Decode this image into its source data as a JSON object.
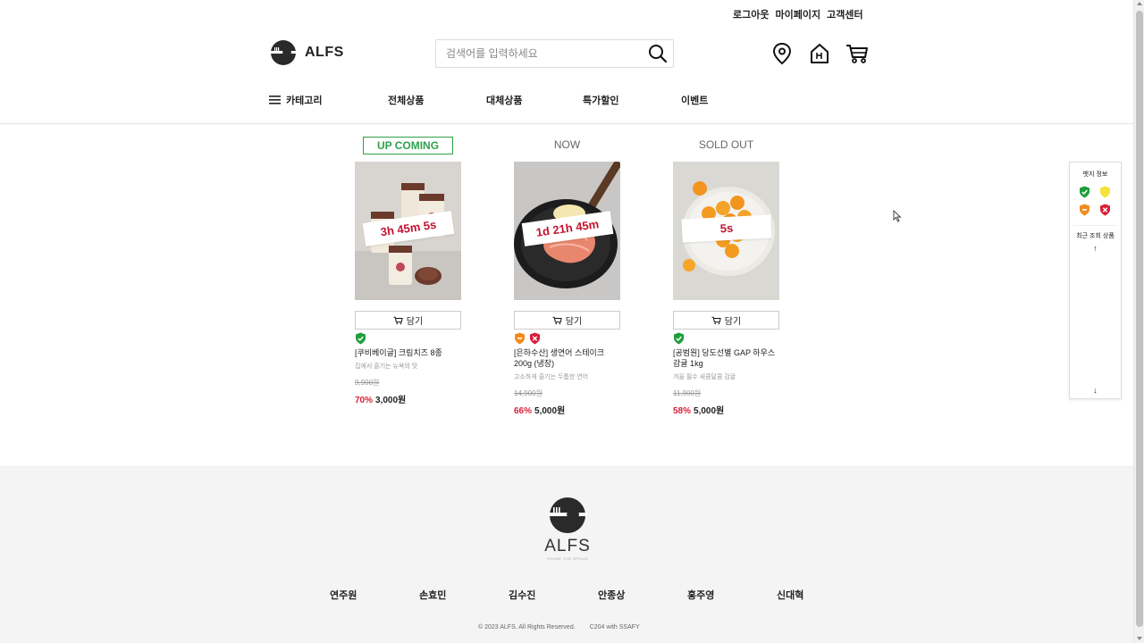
{
  "top_links": [
    "로그아웃",
    "마이페이지",
    "고객센터"
  ],
  "header": {
    "logo_text": "ALFS",
    "search_placeholder": "검색어를 입력하세요"
  },
  "nav": {
    "category": "카테고리",
    "items": [
      "전체상품",
      "대체상품",
      "특가할인",
      "이벤트"
    ]
  },
  "products": [
    {
      "status": "UP COMING",
      "timer": "3h 45m 5s",
      "cart_label": "담기",
      "name": "[쿠비베이글] 크림치즈 8종",
      "desc": "집에서 즐기는 뉴욕의 맛",
      "orig_price": "9,900원",
      "discount": "70%",
      "price": "3,000원",
      "badges": [
        "green"
      ]
    },
    {
      "status": "NOW",
      "timer": "1d 21h 45m",
      "cart_label": "담기",
      "name": "[은하수산] 생연어 스테이크 200g (냉장)",
      "desc": "고소하게 즐기는 두툼한 연어",
      "orig_price": "14,900원",
      "discount": "66%",
      "price": "5,000원",
      "badges": [
        "orange",
        "red"
      ]
    },
    {
      "status": "SOLD OUT",
      "timer": "5s",
      "cart_label": "담기",
      "name": "[공범원] 당도선별 GAP 하우스 감귤 1kg",
      "desc": "겨울 필수 새콤달콤 감귤",
      "orig_price": "11,900원",
      "discount": "58%",
      "price": "5,000원",
      "badges": [
        "green"
      ]
    }
  ],
  "side_panel": {
    "title": "뱃지 정보",
    "recent": "최근 조회 상품",
    "badge_colors": [
      "green",
      "yellow",
      "orange",
      "red"
    ]
  },
  "footer": {
    "logo_text": "ALFS",
    "tagline": "SHARE THE SPOON",
    "members": [
      "연주원",
      "손효민",
      "김수진",
      "안종상",
      "홍주영",
      "신대혁"
    ],
    "copyright": "© 2023 ALFS. All Rights Reserved.",
    "credit": "C204 with SSAFY"
  },
  "colors": {
    "green": "#1f9e3a",
    "yellow": "#f3e33a",
    "orange": "#f08c1e",
    "red": "#d8203a",
    "accent_red": "#c2122f"
  }
}
